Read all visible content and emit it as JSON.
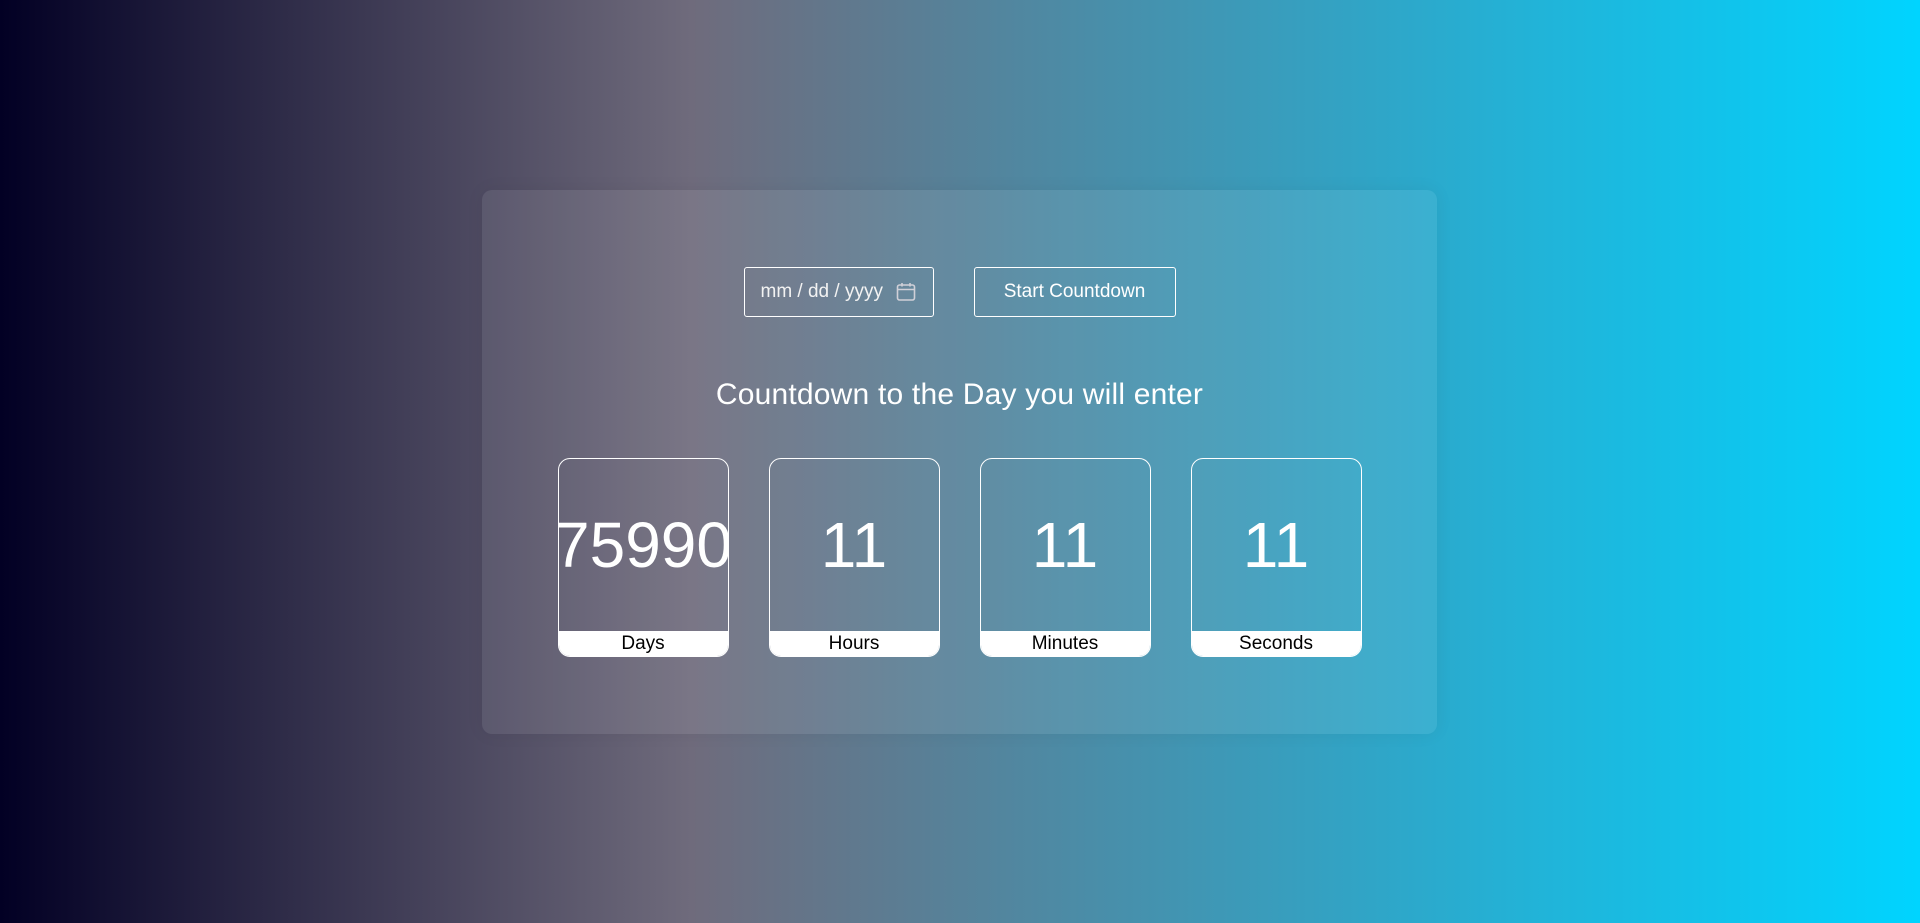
{
  "form": {
    "date_placeholder": "mm / dd / yyyy",
    "date_icon": "calendar-icon",
    "start_label": "Start Countdown"
  },
  "heading": "Countdown to the Day you will enter",
  "countdown": {
    "days": {
      "value": "75990",
      "label": "Days"
    },
    "hours": {
      "value": "11",
      "label": "Hours"
    },
    "minutes": {
      "value": "11",
      "label": "Minutes"
    },
    "seconds": {
      "value": "11",
      "label": "Seconds"
    }
  },
  "colors": {
    "gradient_start": "#020024",
    "gradient_mid": "#6f6b7c",
    "gradient_end": "#00d4ff",
    "text": "#ffffff",
    "label_bg": "#ffffff"
  }
}
